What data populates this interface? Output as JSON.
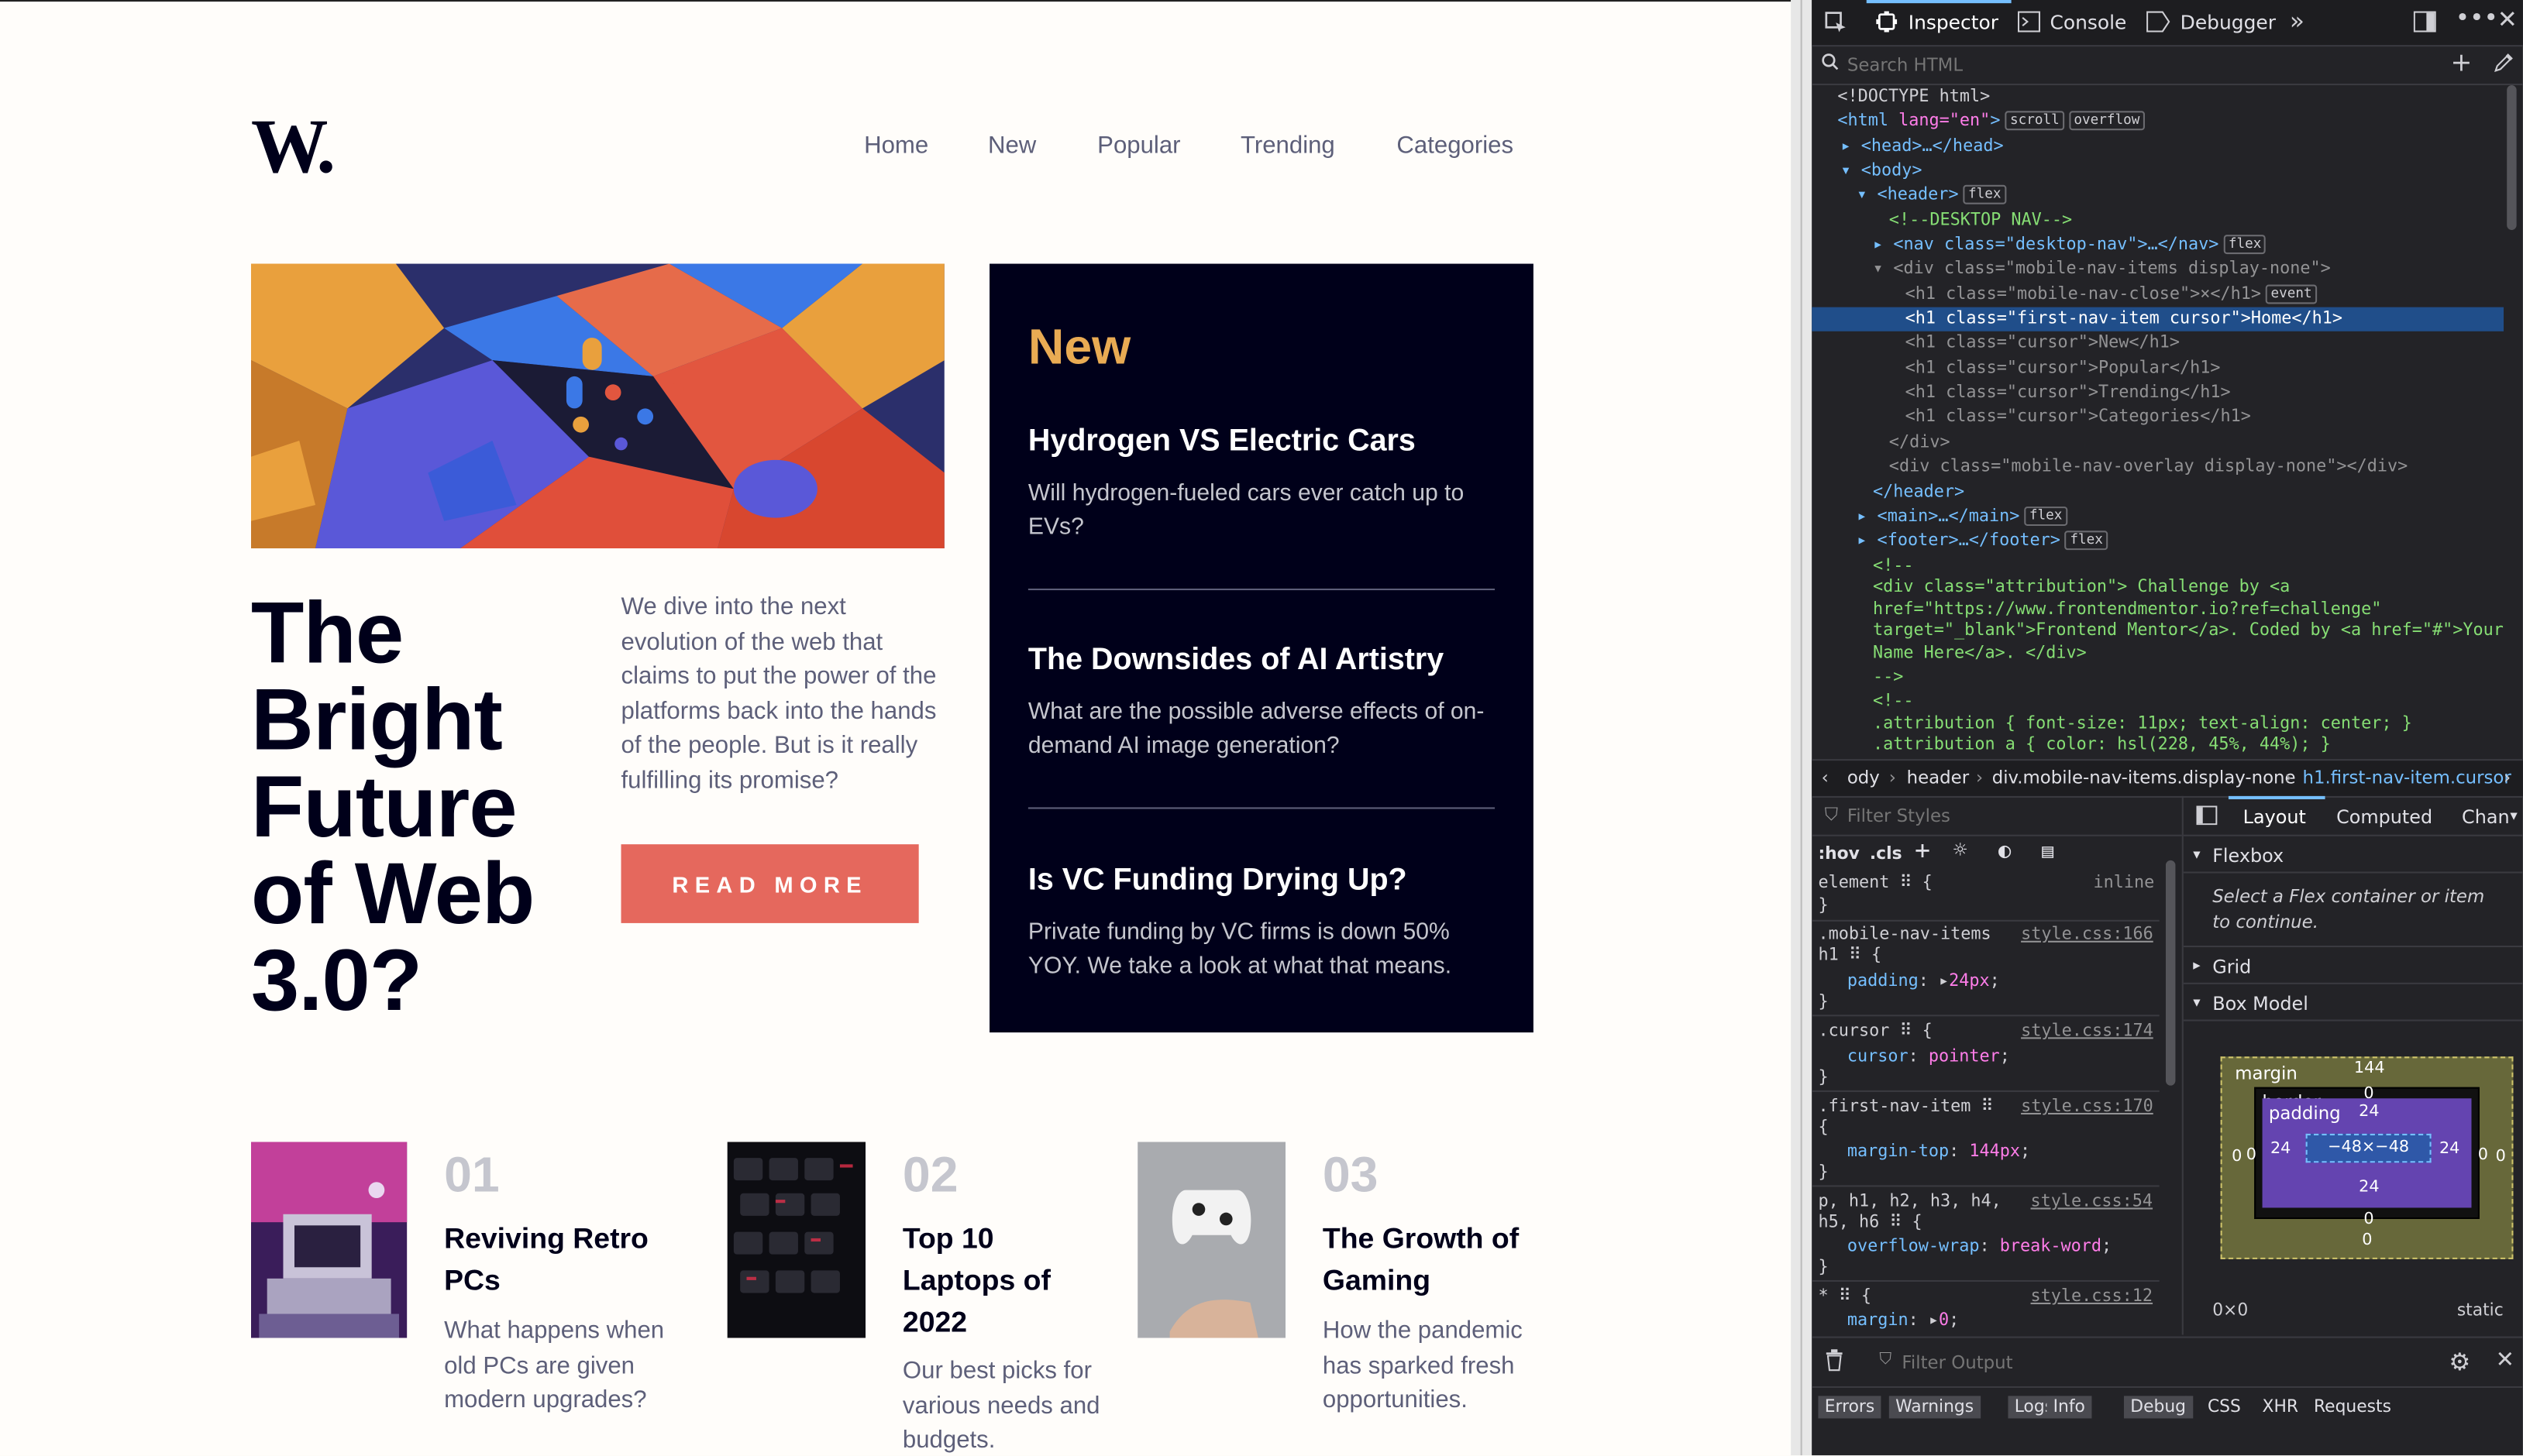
{
  "site": {
    "logo": "W.",
    "nav": [
      "Home",
      "New",
      "Popular",
      "Trending",
      "Categories"
    ],
    "hero": {
      "title_lines": [
        "The",
        "Bright",
        "Future",
        "of Web",
        "3.0?"
      ],
      "description": "We dive into the next evolution of the web that claims to put the power of the platforms back into the hands of the people. But is it really fulfilling its promise?",
      "button": "READ MORE"
    },
    "new_panel": {
      "heading": "New",
      "items": [
        {
          "title": "Hydrogen VS Electric Cars",
          "desc": "Will hydrogen-fueled cars ever catch up to EVs?"
        },
        {
          "title": "The Downsides of AI Artistry",
          "desc": "What are the possible adverse effects of on-demand AI image generation?"
        },
        {
          "title": "Is VC Funding Drying Up?",
          "desc": "Private funding by VC firms is down 50% YOY. We take a look at what that means."
        }
      ]
    },
    "cards": [
      {
        "num": "01",
        "title": "Reviving Retro PCs",
        "desc": "What happens when old PCs are given modern upgrades?"
      },
      {
        "num": "02",
        "title": "Top 10 Laptops of 2022",
        "desc": "Our best picks for various needs and budgets."
      },
      {
        "num": "03",
        "title": "The Growth of Gaming",
        "desc": "How the pandemic has sparked fresh opportunities."
      }
    ],
    "colors": {
      "dark": "#00001a",
      "accent_red": "#e5685d",
      "accent_gold": "#e9ab53",
      "body_text": "#5d5f79",
      "background": "#fffdfa"
    }
  },
  "devtools": {
    "tabs": [
      "Inspector",
      "Console",
      "Debugger"
    ],
    "active_tab": "Inspector",
    "search_placeholder": "Search HTML",
    "tree": [
      {
        "text": "<!DOCTYPE html>"
      },
      {
        "tag": "html",
        "attrs": "lang=\"en\"",
        "badges": [
          "scroll",
          "overflow"
        ]
      },
      {
        "text": "<head>…</head>"
      },
      {
        "text": "<body>"
      },
      {
        "tag": "header",
        "badges": [
          "flex"
        ]
      },
      {
        "comment": "<!--DESKTOP NAV-->"
      },
      {
        "text": "<nav class=\"desktop-nav\">…</nav>",
        "badges": [
          "flex"
        ]
      },
      {
        "text": "<div class=\"mobile-nav-items display-none\">"
      },
      {
        "text": "<h1 class=\"mobile-nav-close\">×</h1>",
        "badges": [
          "event"
        ]
      },
      {
        "text": "<h1 class=\"first-nav-item cursor\">Home</h1>",
        "selected": true
      },
      {
        "text": "<h1 class=\"cursor\">New</h1>"
      },
      {
        "text": "<h1 class=\"cursor\">Popular</h1>"
      },
      {
        "text": "<h1 class=\"cursor\">Trending</h1>"
      },
      {
        "text": "<h1 class=\"cursor\">Categories</h1>"
      },
      {
        "text": "</div>"
      },
      {
        "text": "<div class=\"mobile-nav-overlay display-none\"></div>"
      },
      {
        "text": "</header>"
      },
      {
        "text": "<main>…</main>",
        "badges": [
          "flex"
        ]
      },
      {
        "text": "<footer>…</footer>",
        "badges": [
          "flex"
        ]
      },
      {
        "comment": "<!--"
      },
      {
        "comment": "<div class=\"attribution\"> Challenge by <a href=\"https://www.frontendmentor.io?ref=challenge\" target=\"_blank\">Frontend Mentor</a>. Coded by <a href=\"#\">Your Name Here</a>. </div>"
      },
      {
        "comment": "-->"
      },
      {
        "comment": "<!--"
      },
      {
        "comment": ".attribution { font-size: 11px; text-align: center; }"
      },
      {
        "comment": ".attribution a { color: hsl(228, 45%, 44%); }"
      }
    ],
    "breadcrumbs": [
      "ody",
      "header",
      "div.mobile-nav-items.display-none",
      "h1.first-nav-item.cursor"
    ],
    "rules_filter_placeholder": "Filter Styles",
    "rules_buttons": [
      ":hov",
      ".cls"
    ],
    "rules": [
      {
        "selector": "element",
        "source": "inline",
        "decls": []
      },
      {
        "selector": ".mobile-nav-items h1",
        "source": "style.css:166",
        "decls": [
          {
            "prop": "padding",
            "value": "24px"
          }
        ]
      },
      {
        "selector": ".cursor",
        "source": "style.css:174",
        "decls": [
          {
            "prop": "cursor",
            "value": "pointer"
          }
        ]
      },
      {
        "selector": ".first-nav-item",
        "source": "style.css:170",
        "decls": [
          {
            "prop": "margin-top",
            "value": "144px"
          }
        ]
      },
      {
        "selector": "p, h1, h2, h3, h4, h5, h6",
        "source": "style.css:54",
        "decls": [
          {
            "prop": "overflow-wrap",
            "value": "break-word"
          }
        ]
      },
      {
        "selector": "*",
        "source": "style.css:12",
        "decls": [
          {
            "prop": "margin",
            "value": "0"
          }
        ]
      }
    ],
    "layout_tabs": [
      "Layout",
      "Computed",
      "Chan"
    ],
    "layout_active": "Layout",
    "flexbox_label": "Flexbox",
    "flexbox_hint": "Select a Flex container or item to continue.",
    "grid_label": "Grid",
    "box_model_label": "Box Model",
    "box_model": {
      "margin_label": "margin",
      "border_label": "border",
      "padding_label": "padding",
      "margin": {
        "top": "144",
        "right": "0",
        "bottom": "0",
        "left": "0"
      },
      "border": {
        "top": "0",
        "right": "0",
        "bottom": "0",
        "left": "0"
      },
      "padding": {
        "top": "24",
        "right": "24",
        "bottom": "24",
        "left": "24"
      },
      "content": "−48×−48",
      "size": "0×0",
      "position": "static"
    },
    "console_filter_placeholder": "Filter Output",
    "console_tabs": [
      "Errors",
      "Warnings",
      "Logs",
      "Info",
      "Debug",
      "CSS",
      "XHR",
      "Requests"
    ]
  }
}
